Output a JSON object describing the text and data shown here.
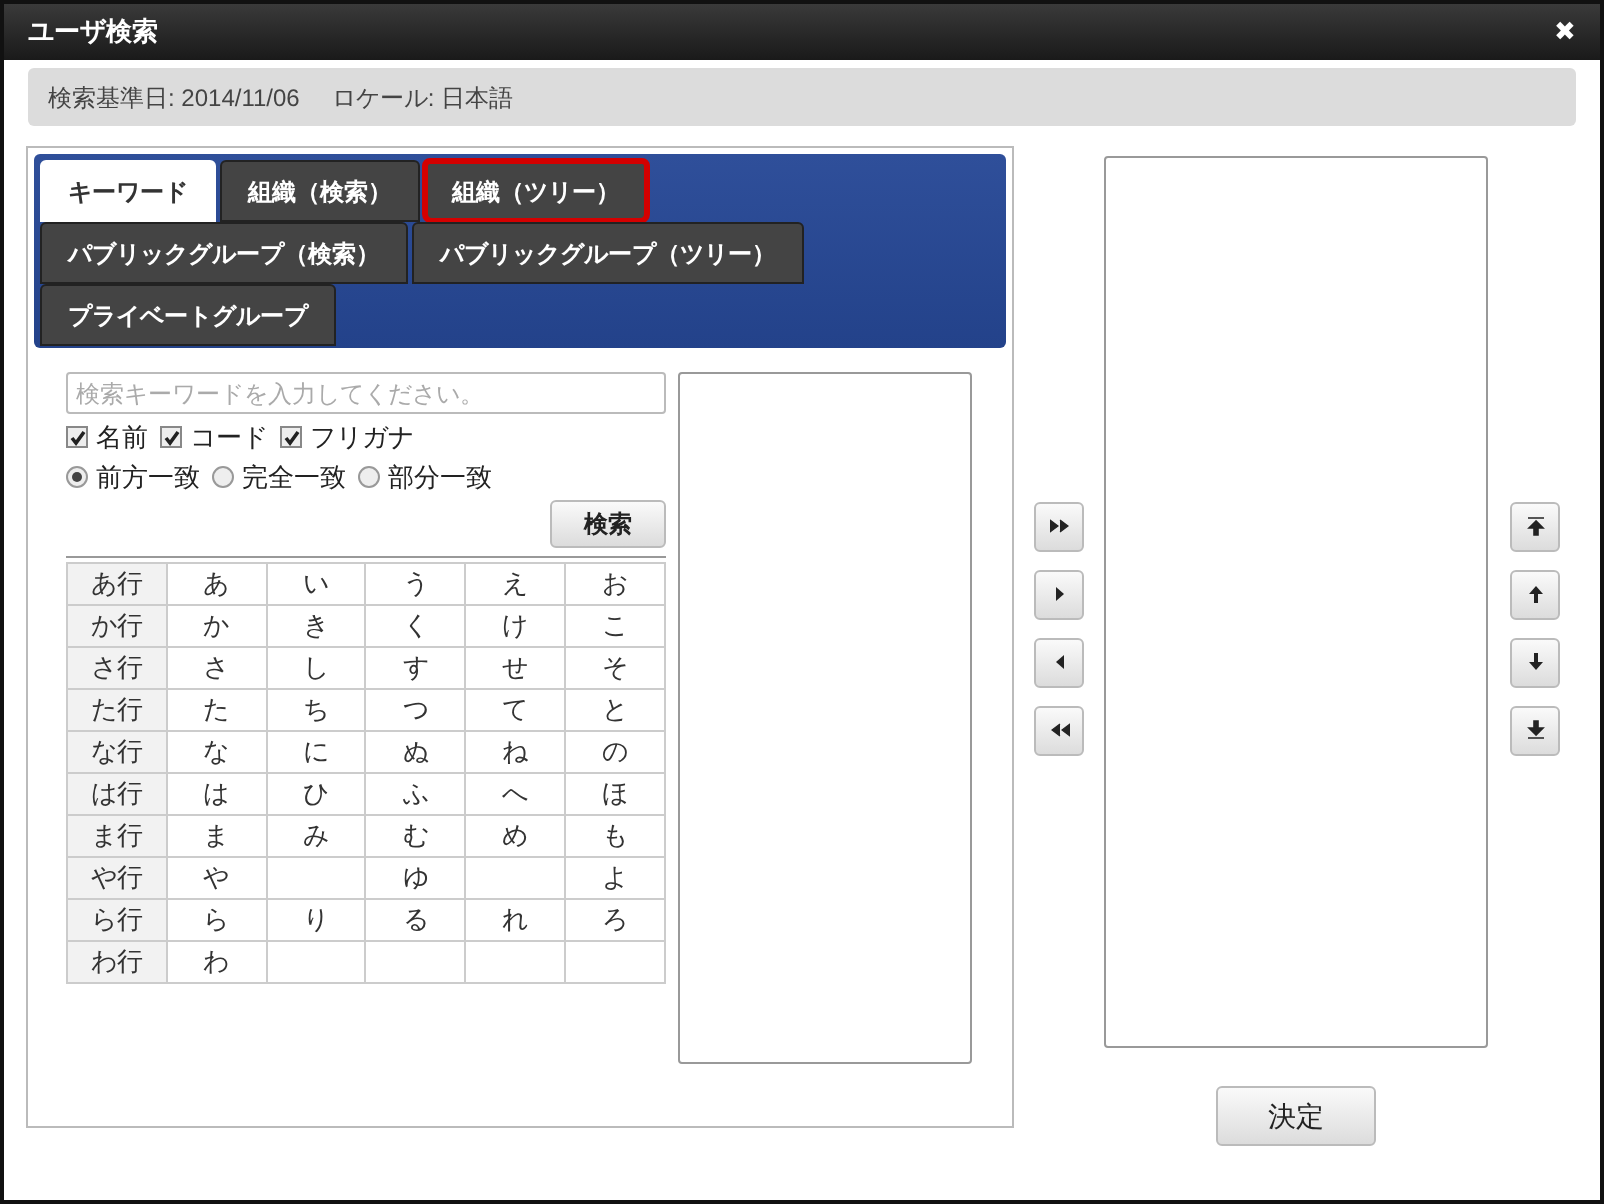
{
  "window": {
    "title": "ユーザ検索",
    "close": "✖"
  },
  "info_bar": {
    "date_label": "検索基準日: 2014/11/06",
    "locale_label": "ロケール: 日本語"
  },
  "tab_rows": [
    [
      {
        "label": "キーワード",
        "selected": true,
        "highlighted": false
      },
      {
        "label": "組織（検索）",
        "selected": false,
        "highlighted": false
      },
      {
        "label": "組織（ツリー）",
        "selected": false,
        "highlighted": true
      }
    ],
    [
      {
        "label": "パブリックグループ（検索）",
        "selected": false,
        "highlighted": false
      },
      {
        "label": "パブリックグループ（ツリー）",
        "selected": false,
        "highlighted": false
      }
    ],
    [
      {
        "label": "プライベートグループ",
        "selected": false,
        "highlighted": false
      }
    ]
  ],
  "search": {
    "placeholder": "検索キーワードを入力してください。"
  },
  "fields": [
    {
      "label": "名前",
      "checked": true
    },
    {
      "label": "コード",
      "checked": true
    },
    {
      "label": "フリガナ",
      "checked": true
    }
  ],
  "match_modes": [
    {
      "label": "前方一致",
      "selected": true
    },
    {
      "label": "完全一致",
      "selected": false
    },
    {
      "label": "部分一致",
      "selected": false
    }
  ],
  "search_button": "検索",
  "kana_rows": [
    {
      "row": "あ行",
      "cells": [
        "あ",
        "い",
        "う",
        "え",
        "お"
      ]
    },
    {
      "row": "か行",
      "cells": [
        "か",
        "き",
        "く",
        "け",
        "こ"
      ]
    },
    {
      "row": "さ行",
      "cells": [
        "さ",
        "し",
        "す",
        "せ",
        "そ"
      ]
    },
    {
      "row": "た行",
      "cells": [
        "た",
        "ち",
        "つ",
        "て",
        "と"
      ]
    },
    {
      "row": "な行",
      "cells": [
        "な",
        "に",
        "ぬ",
        "ね",
        "の"
      ]
    },
    {
      "row": "は行",
      "cells": [
        "は",
        "ひ",
        "ふ",
        "へ",
        "ほ"
      ]
    },
    {
      "row": "ま行",
      "cells": [
        "ま",
        "み",
        "む",
        "め",
        "も"
      ]
    },
    {
      "row": "や行",
      "cells": [
        "や",
        null,
        "ゆ",
        null,
        "よ"
      ]
    },
    {
      "row": "ら行",
      "cells": [
        "ら",
        "り",
        "る",
        "れ",
        "ろ"
      ]
    },
    {
      "row": "わ行",
      "cells": [
        "わ",
        null,
        null,
        null,
        null
      ]
    }
  ],
  "confirm_button": "決定"
}
